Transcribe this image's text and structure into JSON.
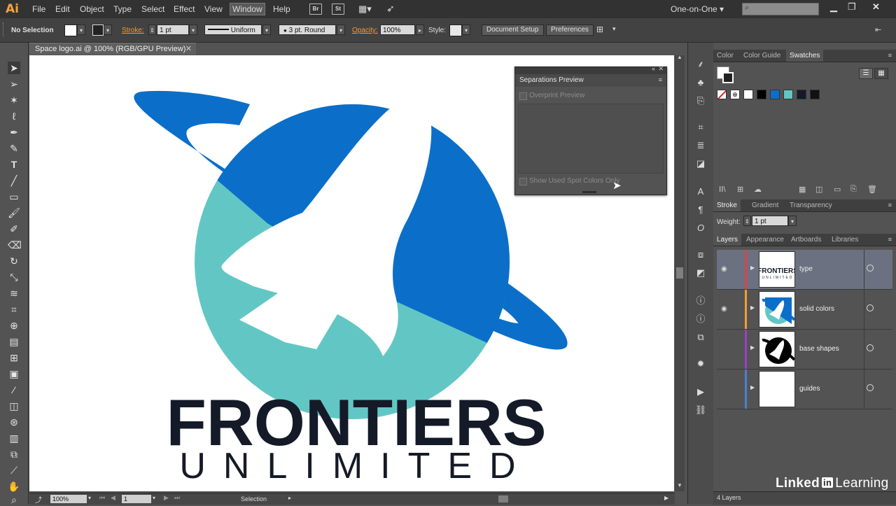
{
  "app": {
    "logo": "Ai"
  },
  "menu": [
    "File",
    "Edit",
    "Object",
    "Type",
    "Select",
    "Effect",
    "View",
    "Window",
    "Help"
  ],
  "menu_active": "Window",
  "toolbar_icons": {
    "bridge": "Br",
    "stock": "St"
  },
  "workspace": "One-on-One",
  "control_bar": {
    "selection": "No Selection",
    "stroke_label": "Stroke:",
    "stroke_value": "1 pt",
    "stroke_profile": "Uniform",
    "brush": "3 pt. Round",
    "opacity_label": "Opacity:",
    "opacity_value": "100%",
    "style_label": "Style:",
    "document_setup": "Document Setup",
    "preferences": "Preferences"
  },
  "document": {
    "tab_title": "Space logo.ai @ 100% (RGB/GPU Preview)"
  },
  "artwork": {
    "brand_main": "FRONTIERS",
    "brand_sub": "UNLIMITED"
  },
  "separations": {
    "title": "Separations Preview",
    "overprint": "Overprint Preview",
    "spot_only": "Show Used Spot Colors Only"
  },
  "swatches_panel": {
    "tabs": [
      "Color",
      "Color Guide",
      "Swatches"
    ]
  },
  "stroke_panel": {
    "tabs": [
      "Stroke",
      "Gradient",
      "Transparency"
    ],
    "weight_label": "Weight:",
    "weight_value": "1 pt"
  },
  "layers_panel": {
    "tabs": [
      "Layers",
      "Appearance",
      "Artboards",
      "Libraries"
    ],
    "layers": [
      {
        "name": "type",
        "color": "#d9434b"
      },
      {
        "name": "solid colors",
        "color": "#f0a030"
      },
      {
        "name": "base shapes",
        "color": "#9b3fc9"
      },
      {
        "name": "guides",
        "color": "#4a7fd6"
      }
    ],
    "count": "4 Layers"
  },
  "status": {
    "zoom": "100%",
    "artboard": "1",
    "mode": "Selection"
  },
  "watermark": {
    "brand": "Linked",
    "in": "in",
    "learning": "Learning"
  },
  "colors": {
    "logo_blue": "#0b6fc9",
    "logo_teal": "#62c7c4",
    "text_dark": "#151a28",
    "accent_orange": "#f29b38"
  }
}
